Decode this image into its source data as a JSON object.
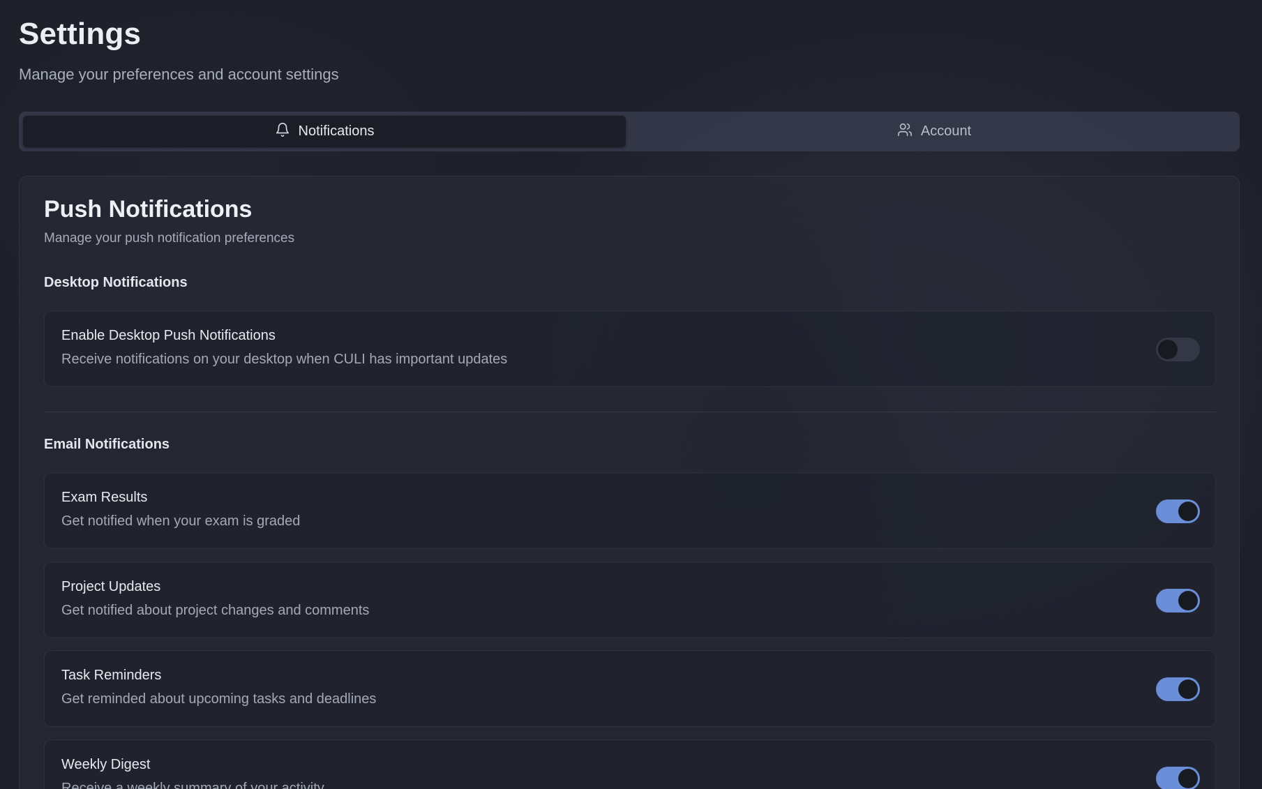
{
  "header": {
    "title": "Settings",
    "subtitle": "Manage your preferences and account settings"
  },
  "tabs": [
    {
      "label": "Notifications",
      "icon": "bell-icon",
      "active": true
    },
    {
      "label": "Account",
      "icon": "users-icon",
      "active": false
    }
  ],
  "card": {
    "title": "Push Notifications",
    "subtitle": "Manage your push notification preferences",
    "sections": [
      {
        "heading": "Desktop Notifications",
        "items": [
          {
            "label": "Enable Desktop Push Notifications",
            "description": "Receive notifications on your desktop when CULI has important updates",
            "enabled": false
          }
        ]
      },
      {
        "heading": "Email Notifications",
        "items": [
          {
            "label": "Exam Results",
            "description": "Get notified when your exam is graded",
            "enabled": true
          },
          {
            "label": "Project Updates",
            "description": "Get notified about project changes and comments",
            "enabled": true
          },
          {
            "label": "Task Reminders",
            "description": "Get reminded about upcoming tasks and deadlines",
            "enabled": true
          },
          {
            "label": "Weekly Digest",
            "description": "Receive a weekly summary of your activity",
            "enabled": true
          }
        ]
      }
    ]
  },
  "colors": {
    "accent": "#6b8ed8",
    "background": "#1d2029",
    "card": "#262935"
  }
}
